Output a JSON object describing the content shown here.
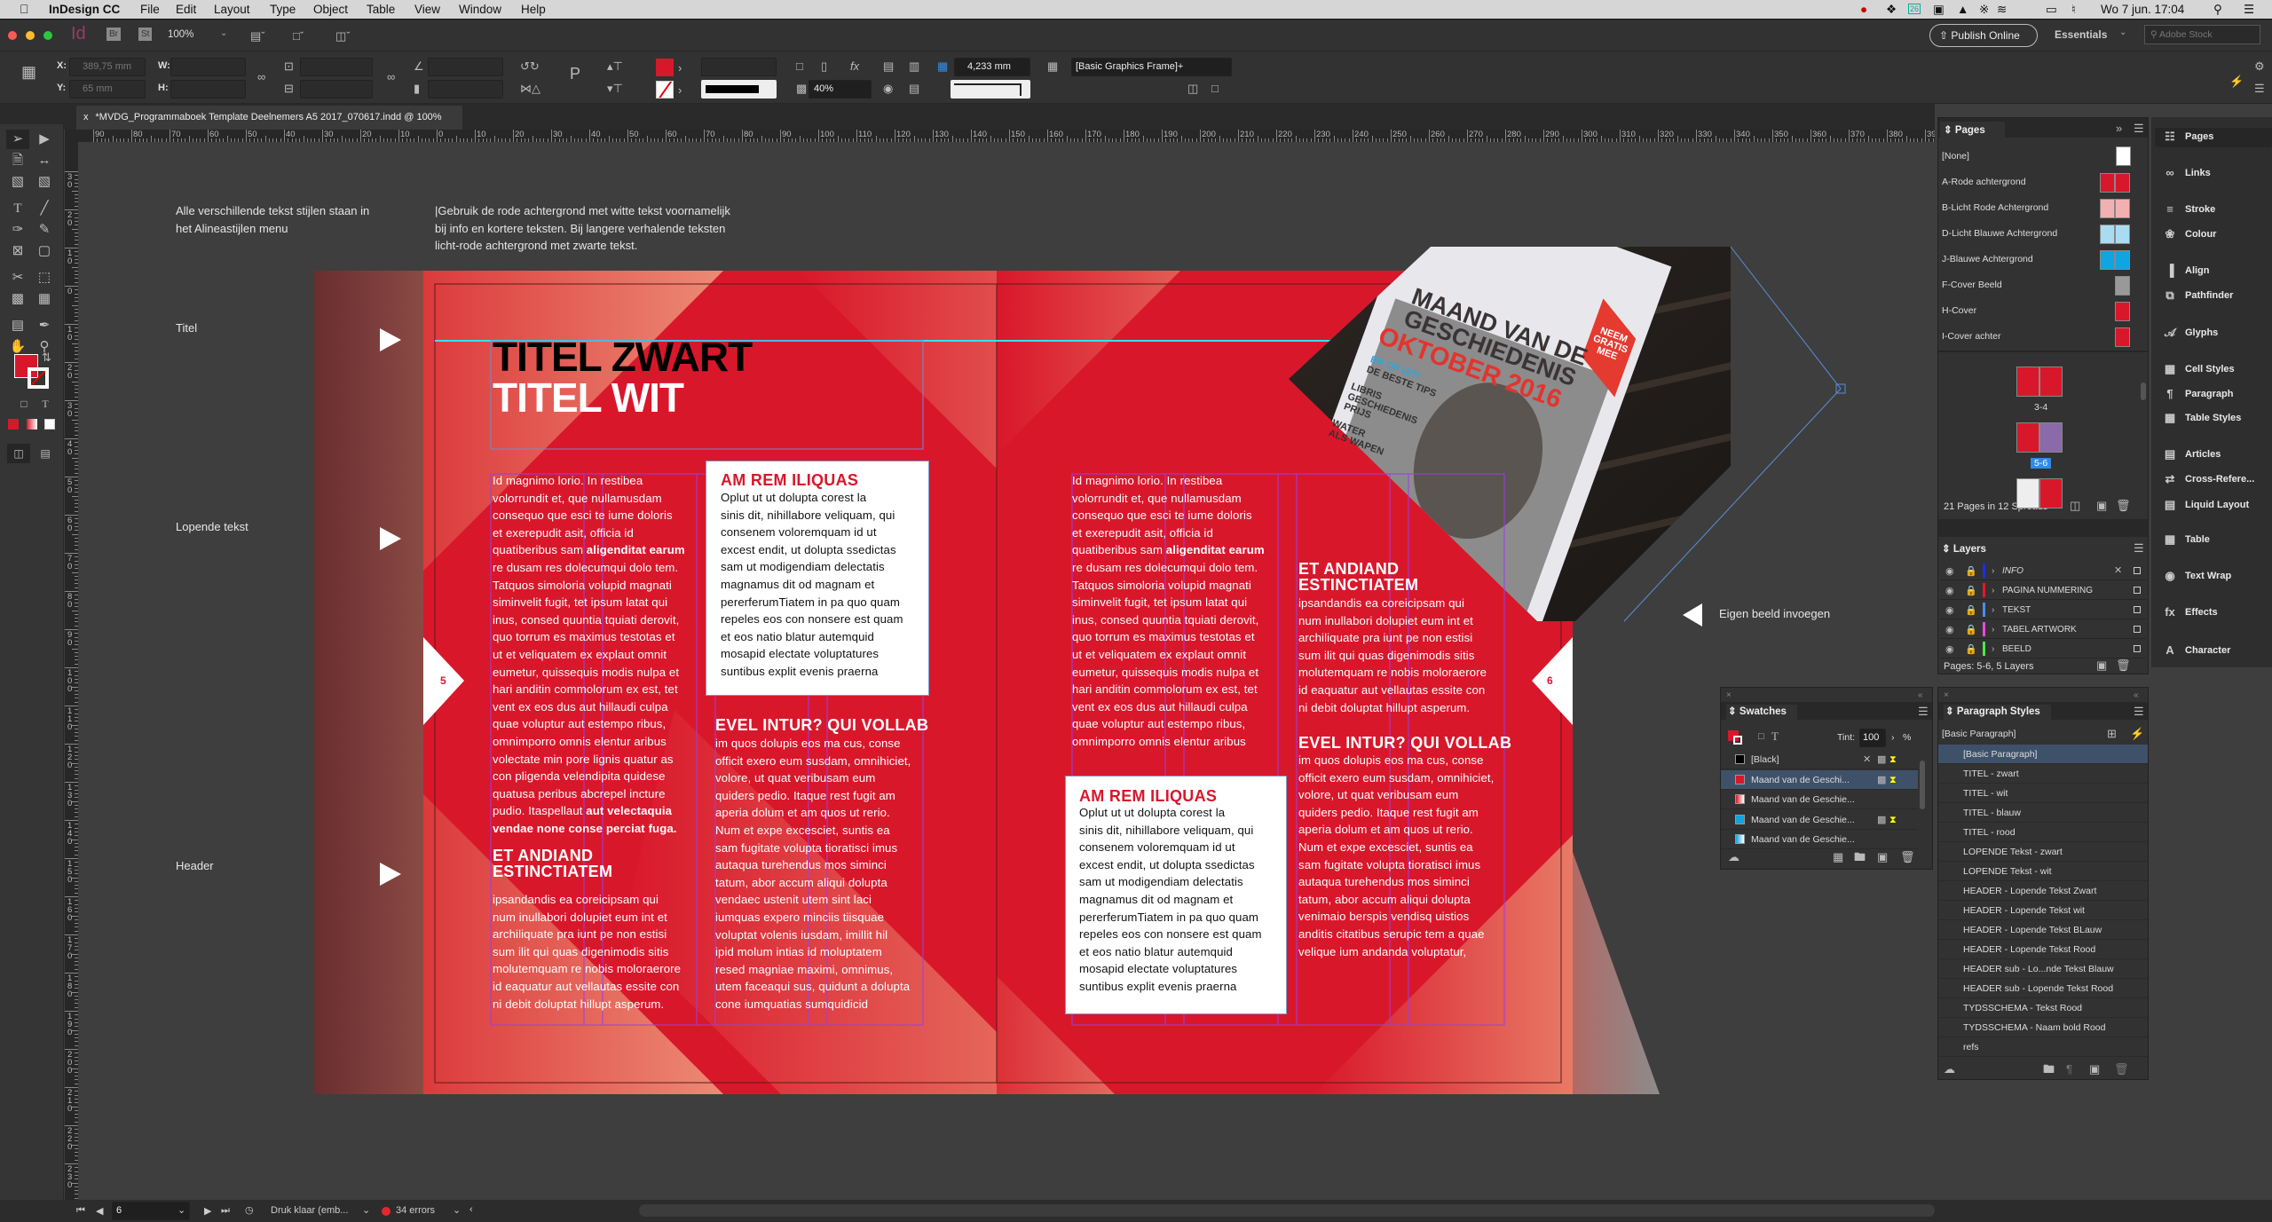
{
  "menubar": {
    "app_name": "InDesign CC",
    "items": [
      "File",
      "Edit",
      "Layout",
      "Type",
      "Object",
      "Table",
      "View",
      "Window",
      "Help"
    ],
    "clock": "Wo 7 jun. 17:04",
    "calendar_badge": "26"
  },
  "appbar": {
    "logo": "Id",
    "bridge": "Br",
    "stock": "St",
    "zoom": "100%",
    "publish_online": "Publish Online",
    "workspace": "Essentials",
    "search_placeholder": "Adobe Stock"
  },
  "control": {
    "x_label": "X:",
    "x_value": "389,75 mm",
    "y_label": "Y:",
    "y_value": "65 mm",
    "w_label": "W:",
    "h_label": "H:",
    "stroke_weight": "4,233 mm",
    "opacity": "40%",
    "object_style": "[Basic Graphics Frame]+",
    "fill_color": "#d9172b"
  },
  "document": {
    "tab_title": "*MVDG_Programmaboek Template Deelnemers A5 2017_070617.indd @ 100%",
    "close": "x"
  },
  "rulers": {
    "horizontal": [
      "90",
      "80",
      "70",
      "60",
      "50",
      "40",
      "30",
      "20",
      "10",
      "0",
      "10",
      "20",
      "30",
      "40",
      "50",
      "60",
      "70",
      "80",
      "90",
      "100",
      "110",
      "120",
      "130",
      "140",
      "150",
      "160",
      "170",
      "180",
      "190",
      "200",
      "210",
      "220",
      "230",
      "240",
      "250",
      "260",
      "270",
      "280",
      "290",
      "300",
      "310",
      "320",
      "330",
      "340",
      "350",
      "360",
      "370",
      "380",
      "390"
    ],
    "vertical": [
      "30",
      "20",
      "10",
      "0",
      "10",
      "20",
      "30",
      "40",
      "50",
      "60",
      "70",
      "80",
      "90",
      "100",
      "110",
      "120",
      "130",
      "140",
      "150",
      "160",
      "170",
      "180",
      "190",
      "200",
      "210",
      "220",
      "230"
    ]
  },
  "pasteboard": {
    "note_styles": "Alle verschillende tekst stijlen staan in\nhet Alineastijlen menu",
    "note_background": "|Gebruik de rode achtergrond met witte tekst voornamelijk\nbij info en kortere teksten. Bij langere verhalende teksten\nlicht-rode achtergrond met zwarte tekst.",
    "label_title": "Titel",
    "label_running": "Lopende tekst",
    "label_header": "Header",
    "label_image": "Eigen beeld invoegen"
  },
  "spread": {
    "brand_red": "#d9172b",
    "title_black": "TITEL ZWART",
    "title_white": "TITEL WIT",
    "page_left": "5",
    "page_right": "6",
    "body_1a": "Id magnimo lorio. In restibea\nvolorrundit et, que nullamusdam\nconsequo que esci te iume doloris\net exerepudit asit, officia id\nquatiberibus sam ",
    "body_1b_bold": "aligenditat earum",
    "body_1c": "\nre dusam res dolecumqui dolo tem.\nTatquos simoloria volupid magnati\nsiminvelit fugit, tet ipsum latat qui\ninus, consed quuntia tquiati derovit,\nquo torrum es maximus testotas et\nut et veliquatem ex explaut omnit\neumetur, quissequis modis nulpa et\nhari anditin commolorum ex est, tet\nvent ex eos dus aut hillaudi culpa\nquae voluptur aut estempo ribus,\nomnimporro omnis elentur aribus",
    "body_1d": "\nvolectate min pore lignis quatur as\ncon pligenda velendipita quidese\nquatusa peribus abcrepel incture\npudio. Itaspellaut ",
    "body_1e_bold": "aut velectaquia\nvendae none conse perciat fuga.",
    "heading_et": "ET ANDIAND\nESTINCTIATEM",
    "body_et": "ipsandandis ea coreicipsam qui\nnum inullabori dolupiet eum int et\narchiliquate pra iunt pe non estisi\nsum ilit qui quas digenimodis sitis\nmolutemquam re nobis moloraerore\nid eaquatur aut vellautas essite con\nni debit doluptat hillupt asperum.",
    "heading_box": "AM REM ILIQUAS",
    "body_box": "Oplut ut ut dolupta corest la\nsinis dit, nihillabore veliquam, qui\nconsenem voloremquam id ut\nexcest endit, ut dolupta ssedictas\nsam ut modigendiam delectatis\nmagnamus dit od magnam et\npererferumTiatem in pa quo quam\nrepeles eos con nonsere est quam\net eos natio blatur autemquid\nmosapid electate voluptatures\nsuntibus explit evenis praerna",
    "heading_evel": "EVEL INTUR? QUI VOLLAB",
    "body_evel_left": "im quos dolupis eos ma cus, conse\nofficit exero eum susdam, omnihiciet,\nvolore, ut quat veribusam eum\nquiders pedio. Itaque rest fugit am\naperia dolum et am quos ut rerio.\nNum et expe excesciet, suntis ea\nsam fugitate volupta tioratisci imus\nautaqua turehendus mos siminci\ntatum, abor accum aliqui dolupta\nvendaec ustenit utem sint laci\niumquas expero minciis tiisquae\nvoluptat volenis iusdam, imillit hil\nipid molum intias id moluptatem\nresed magniae maximi, omnimus,\nutem faceaqui sus, quidunt a dolupta\ncone iumquatias sumquidicid",
    "body_evel_right": "im quos dolupis eos ma cus, conse\nofficit exero eum susdam, omnihiciet,\nvolore, ut quat veribusam eum\nquiders pedio. Itaque rest fugit am\naperia dolum et am quos ut rerio.\nNum et expe excesciet, suntis ea\nsam fugitate volupta tioratisci imus\nautaqua turehendus mos siminci\ntatum, abor accum aliqui dolupta\nvenimaio berspis vendisq uistios\nanditis citatibus serupic tem a quae\nvelique ium andanda voluptatur,",
    "photo": {
      "masthead": "MAAND VAN DE\nGESCHIEDENIS",
      "issue": "OKTOBER 2016",
      "badge": "NEEM\nGRATIS\nMEE",
      "teaser_1": "ER OP UIT!",
      "teaser_2": "DE BESTE TIPS",
      "teaser_3": "LIBRIS\nGESCHIEDENIS\nPRIJS",
      "teaser_4": "WATER\nALS WAPEN"
    }
  },
  "pages_panel": {
    "title": "Pages",
    "masters": [
      {
        "name": "[None]",
        "color": "#ffffff"
      },
      {
        "name": "A-Rode achtergrond",
        "color": "#d9172b"
      },
      {
        "name": "B-Licht Rode Achtergrond",
        "color": "#f3b0b0"
      },
      {
        "name": "D-Licht Blauwe Achtergrond",
        "color": "#a9dcf3"
      },
      {
        "name": "J-Blauwe Achtergrond",
        "color": "#0ea5e0"
      },
      {
        "name": "F-Cover Beeld",
        "color": "#999999"
      },
      {
        "name": "H-Cover",
        "color": "#d9172b"
      },
      {
        "name": "I-Cover achter",
        "color": "#d9172b"
      }
    ],
    "spreads": [
      {
        "label": "3-4",
        "master": "A"
      },
      {
        "label": "5-6",
        "master": "A",
        "selected": true
      },
      {
        "label": "",
        "master": "B"
      }
    ],
    "footer": "21 Pages in 12 Spreads"
  },
  "layers_panel": {
    "title": "Layers",
    "layers": [
      {
        "name": "INFO",
        "color": "#1b2ee8"
      },
      {
        "name": "PAGINA NUMMERING",
        "color": "#e8162a"
      },
      {
        "name": "TEKST",
        "color": "#4a8ee8"
      },
      {
        "name": "TABEL ARTWORK",
        "color": "#e84ae0"
      },
      {
        "name": "BEELD",
        "color": "#4ae84a"
      }
    ],
    "footer": "Pages: 5-6, 5 Layers"
  },
  "dock": {
    "items": [
      "Pages",
      "Links",
      "Stroke",
      "Colour",
      "Align",
      "Pathfinder",
      "Glyphs",
      "Cell Styles",
      "Paragraph",
      "Table Styles",
      "Articles",
      "Cross-Refere...",
      "Liquid Layout",
      "Table",
      "Text Wrap",
      "Effects",
      "Character"
    ]
  },
  "swatches_panel": {
    "title": "Swatches",
    "tint_label": "Tint:",
    "tint_value": "100",
    "percent": "%",
    "swatches": [
      {
        "name": "[Black]",
        "color": "#000000"
      },
      {
        "name": "Maand van de Geschi...",
        "color": "#d9172b",
        "selected": true
      },
      {
        "name": "Maand van de Geschie...",
        "color": "linear-gradient(90deg,#d9172b,#fff)"
      },
      {
        "name": "Maand van de Geschie...",
        "color": "#0ea5e0"
      },
      {
        "name": "Maand van de Geschie...",
        "color": "linear-gradient(90deg,#0ea5e0,#fff)"
      }
    ]
  },
  "paragraph_styles_panel": {
    "title": "Paragraph Styles",
    "current": "[Basic Paragraph]",
    "styles": [
      "[Basic Paragraph]",
      "TITEL - zwart",
      "TITEL - wit",
      "TITEL - blauw",
      "TITEL - rood",
      "LOPENDE Tekst - zwart",
      "LOPENDE Tekst - wit",
      "HEADER - Lopende Tekst Zwart",
      "HEADER - Lopende Tekst wit",
      "HEADER - Lopende Tekst BLauw",
      "HEADER - Lopende Tekst Rood",
      "HEADER sub - Lo...nde Tekst Blauw",
      "HEADER sub - Lopende Tekst Rood",
      "TYDSSCHEMA - Tekst Rood",
      "TYDSSCHEMA - Naam bold Rood",
      "refs"
    ]
  },
  "status": {
    "page": "6",
    "preflight_profile": "Druk klaar (emb...",
    "errors": "34 errors",
    "error_color": "#e8262a"
  }
}
